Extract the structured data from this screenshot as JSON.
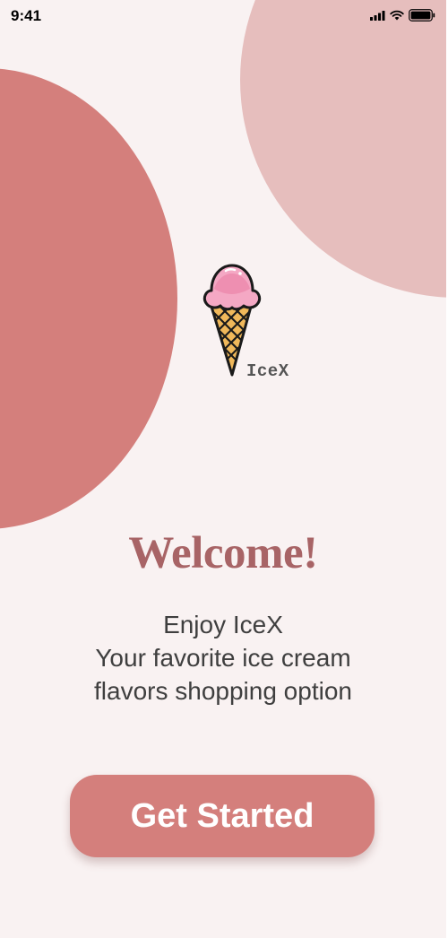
{
  "status_bar": {
    "time": "9:41"
  },
  "logo": {
    "icon": "ice-cream-cone-icon",
    "text": "IceX"
  },
  "welcome": {
    "title": "Welcome!"
  },
  "subtitle": {
    "line1": "Enjoy IceX",
    "line2": "Your favorite ice cream",
    "line3": "flavors shopping option"
  },
  "cta": {
    "label": "Get Started"
  },
  "colors": {
    "background": "#f9f2f2",
    "accent": "#d47f7c",
    "accent_light": "#e6bebd",
    "title": "#a86466",
    "text": "#3f3f3f"
  }
}
